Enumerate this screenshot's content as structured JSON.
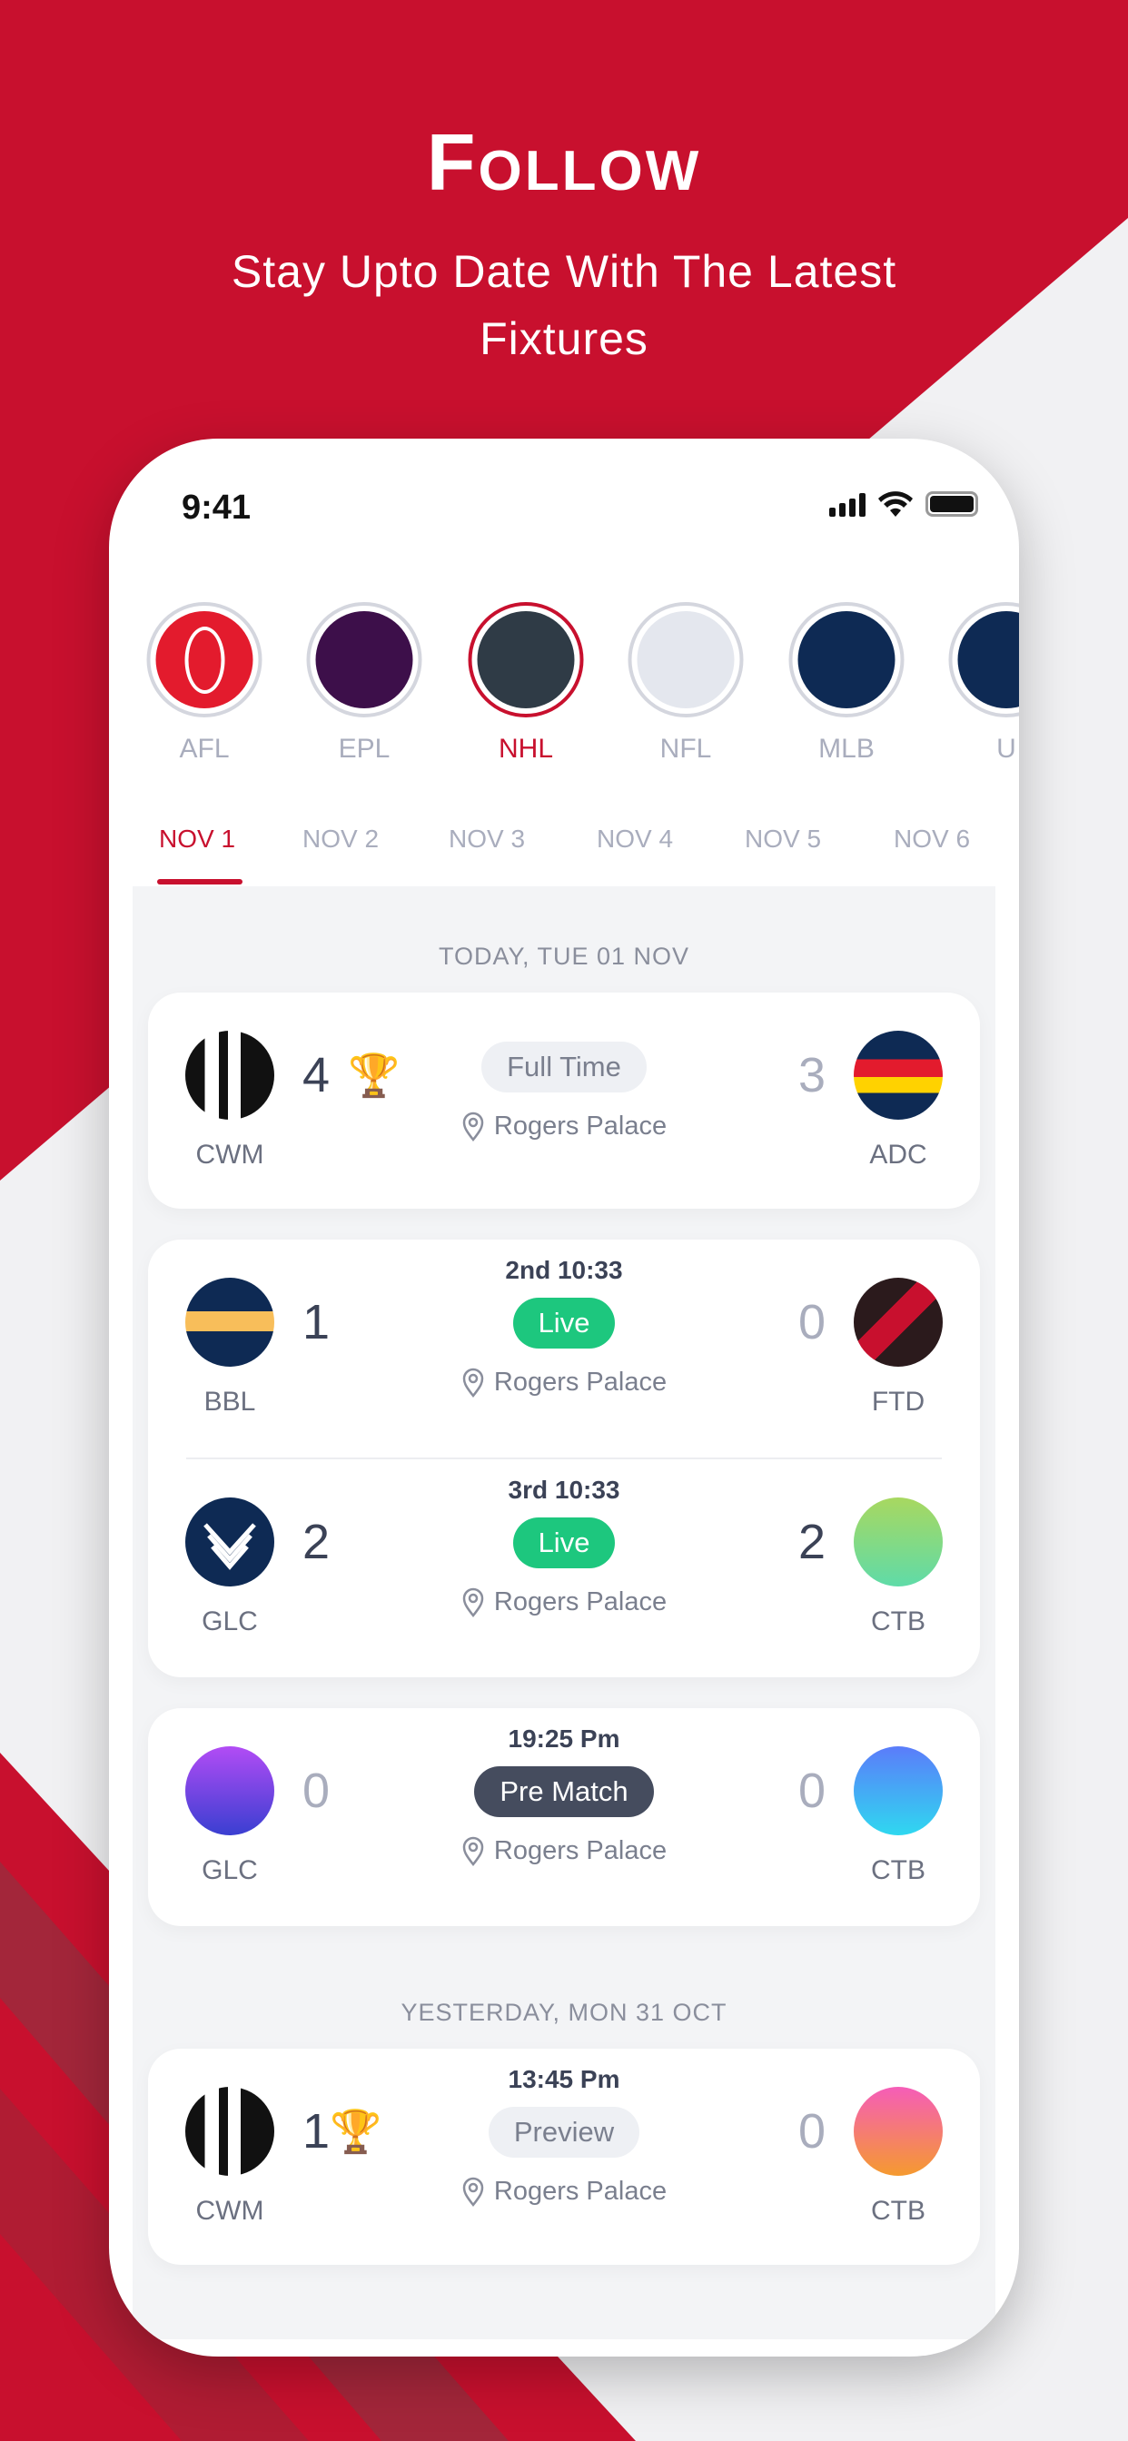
{
  "hero": {
    "title": "Follow",
    "subtitle": "Stay Upto Date With The Latest Fixtures"
  },
  "status_bar": {
    "time": "9:41"
  },
  "leagues": [
    {
      "label": "AFL",
      "color": "#E31B2D",
      "active": false
    },
    {
      "label": "EPL",
      "color": "#3D0F4A",
      "active": false
    },
    {
      "label": "NHL",
      "color": "#2F3B46",
      "active": true
    },
    {
      "label": "NFL",
      "color": "#E4E7EE",
      "active": false
    },
    {
      "label": "MLB",
      "color": "#0E2A54",
      "active": false
    },
    {
      "label": "U",
      "color": "#0E2A54",
      "active": false
    }
  ],
  "date_tabs": [
    "NOV 1",
    "NOV 2",
    "NOV 3",
    "NOV 4",
    "NOV 5",
    "NOV 6"
  ],
  "active_date": "NOV 1",
  "sections": [
    {
      "heading": "TODAY, TUE 01 NOV"
    },
    {
      "heading": "YESTERDAY, MON 31 OCT"
    }
  ],
  "matches": [
    {
      "home": "CWM",
      "home_score": "4",
      "away": "ADC",
      "away_score": "3",
      "status": "Full Time",
      "period": "",
      "venue": "Rogers Palace",
      "winner": "home"
    },
    {
      "home": "BBL",
      "home_score": "1",
      "away": "FTD",
      "away_score": "0",
      "status": "Live",
      "period": "2nd 10:33",
      "venue": "Rogers Palace"
    },
    {
      "home": "GLC",
      "home_score": "2",
      "away": "CTB",
      "away_score": "2",
      "status": "Live",
      "period": "3rd 10:33",
      "venue": "Rogers Palace"
    },
    {
      "home": "GLC",
      "home_score": "0",
      "away": "CTB",
      "away_score": "0",
      "status": "Pre Match",
      "period": "19:25 Pm",
      "venue": "Rogers Palace"
    },
    {
      "home": "CWM",
      "home_score": "1",
      "away": "CTB",
      "away_score": "0",
      "status": "Preview",
      "period": "13:45 Pm",
      "venue": "Rogers Palace",
      "winner": "home"
    }
  ],
  "colors": {
    "brand": "#C8102E",
    "live": "#1DC77E",
    "prematch": "#454C5E"
  }
}
